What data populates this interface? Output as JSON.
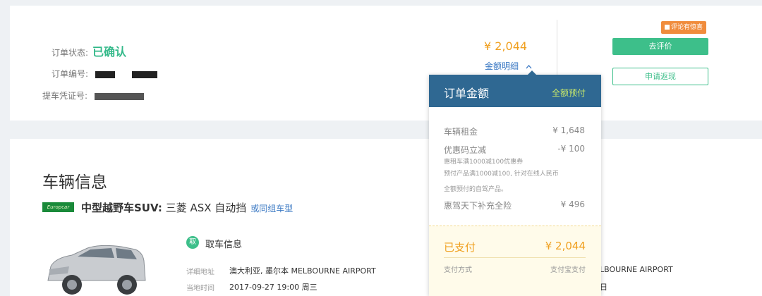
{
  "order": {
    "status_label": "订单状态:",
    "status_value": "已确认",
    "number_label": "订单编号:",
    "voucher_label": "提车凭证号:",
    "total_price": "¥ 2,044",
    "detail_link": "金额明细",
    "review_tag": "评论有惊喜",
    "review_button": "去评价",
    "refund_button": "申请返现"
  },
  "vehicle": {
    "section_title": "车辆信息",
    "brand_badge": "Europcar",
    "car_type": "中型越野车SUV:",
    "car_model": " 三菱 ASX 自动挡",
    "or_similar": "或同组车型",
    "pickup_icon": "取",
    "pickup_title": "取车信息",
    "address_label": "详细地址",
    "address_value": "澳大利亚, 墨尔本 MELBOURNE AIRPORT",
    "time_label": "当地时间",
    "time_value": "2017-09-27 19:00 周三",
    "return_address_fragment": "LBOURNE AIRPORT",
    "return_time_fragment": "日"
  },
  "price_popup": {
    "title": "订单金额",
    "subtitle": "全额预付",
    "items": [
      {
        "label": "车辆租金",
        "value": "¥ 1,648"
      },
      {
        "label": "优惠码立减",
        "value": "-¥ 100"
      },
      {
        "label": "惠驾天下补充全险",
        "value": "¥ 496"
      }
    ],
    "discount_notes": [
      "惠租车满1000减100优惠券",
      "预付产品满1000减100, 针对在线人民币",
      "全额预付的自驾产品。"
    ],
    "paid_label": "已支付",
    "paid_value": "¥ 2,044",
    "method_label": "支付方式",
    "method_value": "支付宝支付"
  }
}
